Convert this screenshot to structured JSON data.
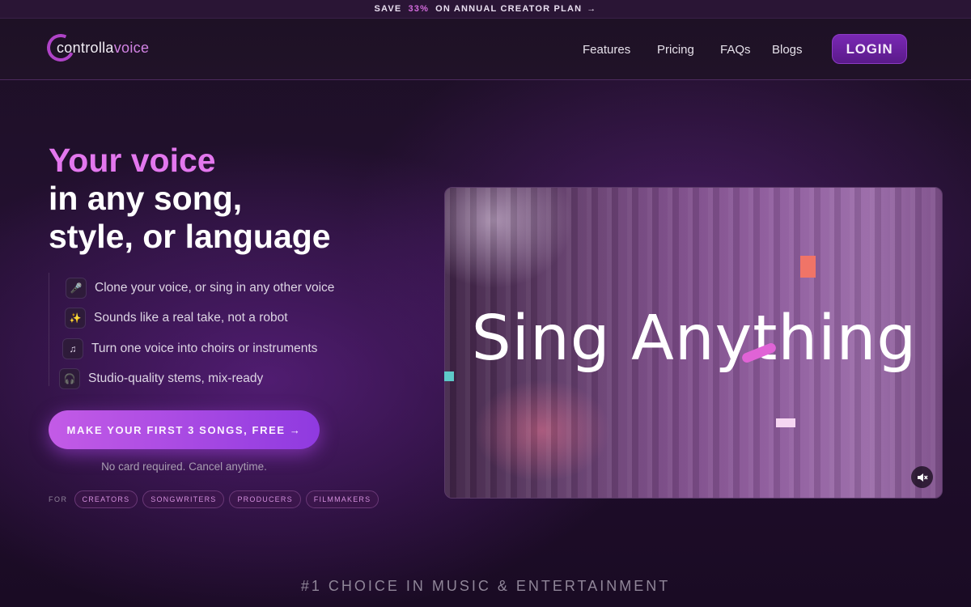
{
  "promo": {
    "pre": "SAVE",
    "percent": "33%",
    "post": "ON ANNUAL CREATOR PLAN",
    "arrow": "→"
  },
  "logo": {
    "part1": "controlla",
    "part2": "voice"
  },
  "nav": [
    {
      "label": "Features"
    },
    {
      "label": "Pricing"
    },
    {
      "label": "FAQs"
    },
    {
      "label": "Blogs"
    }
  ],
  "login_label": "LOGIN",
  "hero": {
    "accent": "Your voice",
    "line2": "in any song,",
    "line3": "style, or language"
  },
  "features": [
    {
      "icon": "microphone-icon",
      "glyph": "🎤",
      "label": "Clone your voice, or sing in any other voice"
    },
    {
      "icon": "sparkle-icon",
      "glyph": "✨",
      "label": "Sounds like a real take, not a robot"
    },
    {
      "icon": "music-note-icon",
      "glyph": "♫",
      "label": "Turn one voice into choirs or instruments"
    },
    {
      "icon": "headphones-icon",
      "glyph": "🎧",
      "label": "Studio-quality stems, mix-ready"
    }
  ],
  "cta_label": "MAKE YOUR FIRST 3 SONGS, FREE →",
  "note": "No card required. Cancel anytime.",
  "for_label": "FOR",
  "chips": [
    "CREATORS",
    "SONGWRITERS",
    "PRODUCERS",
    "FILMMAKERS"
  ],
  "video": {
    "title": "Sing Anything",
    "mute_icon": "speaker-muted-icon"
  },
  "bottom_tagline": "#1 CHOICE IN MUSIC & ENTERTAINMENT",
  "colors": {
    "accent": "#e377ee",
    "button": "#7a28b4",
    "cta_start": "#c35be6",
    "cta_end": "#8f3ae0"
  }
}
